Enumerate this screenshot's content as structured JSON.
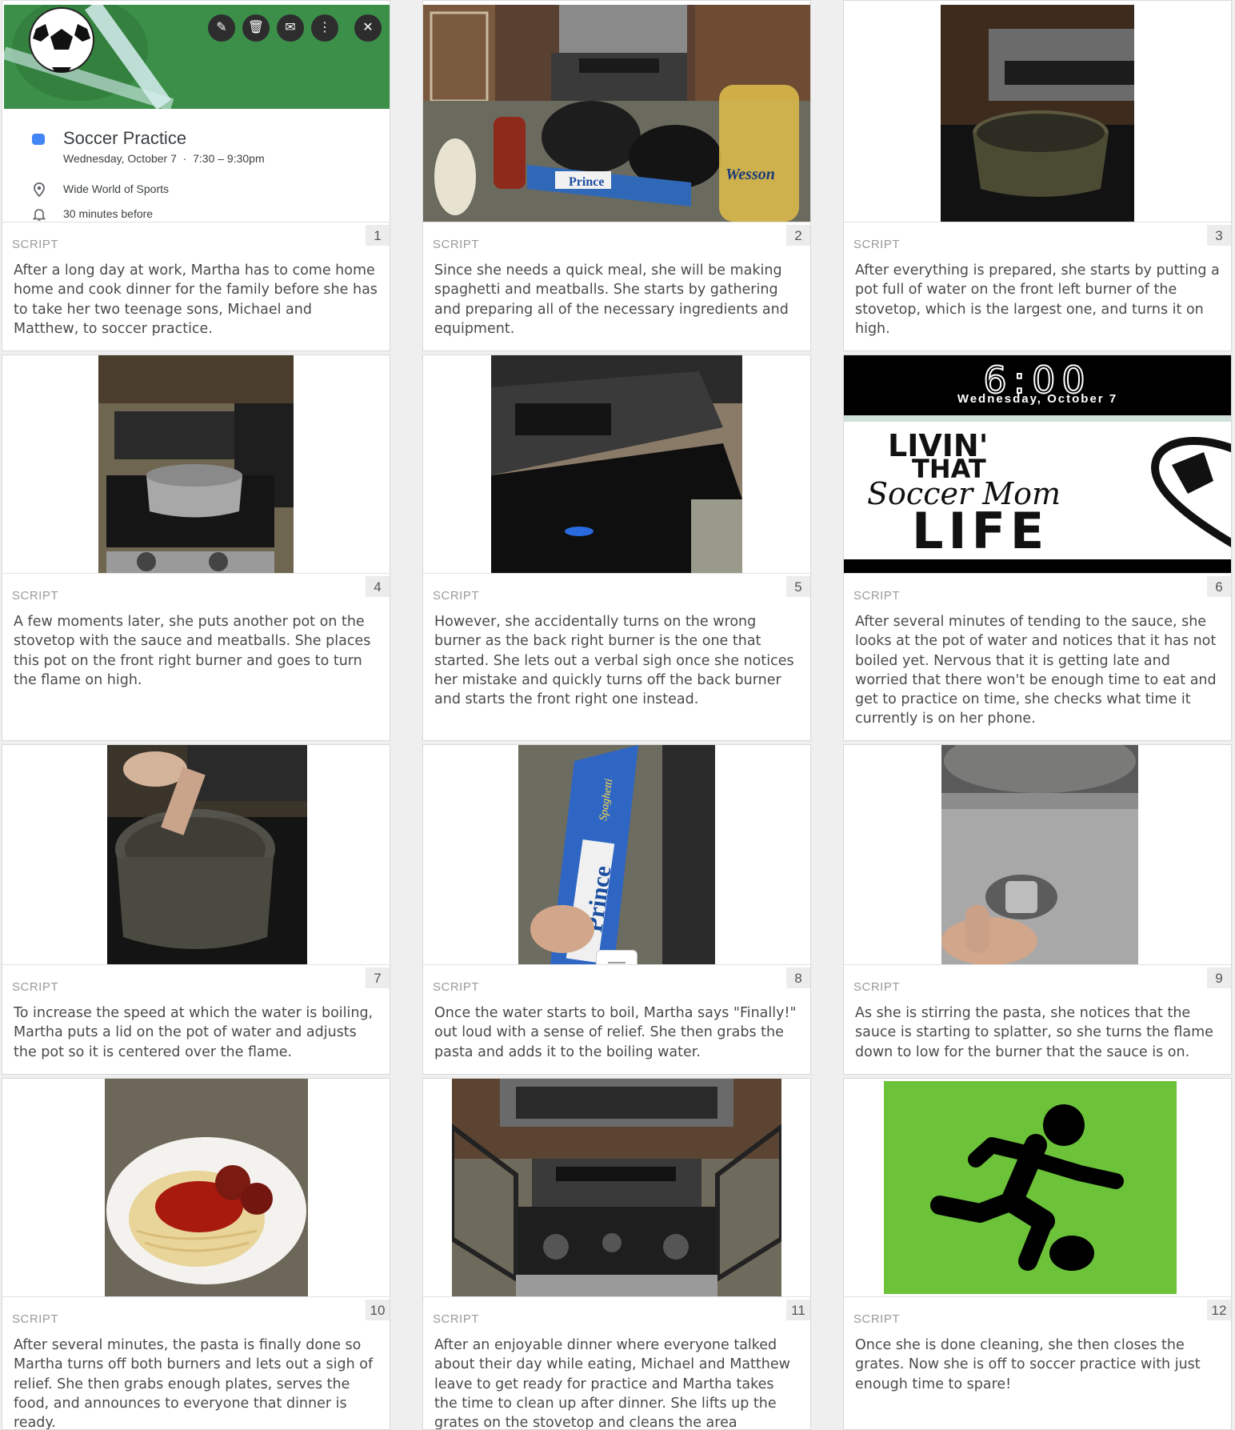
{
  "calendar_event": {
    "title": "Soccer Practice",
    "date_time": "Wednesday, October 7  ·  7:30 – 9:30pm",
    "location": "Wide World of Sports",
    "reminder": "30 minutes before",
    "color": "#4285f4",
    "toolbar": [
      "pencil-icon",
      "trash-icon",
      "envelope-icon",
      "more-vert-icon",
      "close-icon"
    ]
  },
  "phone_lock_screen": {
    "time": "6:00",
    "date": "Wednesday, October 7",
    "graphic_text": [
      "LIVIN'",
      "THAT",
      "Soccer Mom",
      "LIFE"
    ]
  },
  "product_labels": {
    "pasta_brand": "Prince",
    "pasta_type": "Spaghetti",
    "oil_brand": "Wesson"
  },
  "script_label": "SCRIPT",
  "panels": [
    {
      "number": "1",
      "text": "After a long day at work, Martha has to come home home and cook dinner for the family before she has to take her two teenage sons, Michael and Matthew, to soccer practice."
    },
    {
      "number": "2",
      "text": "Since she needs a quick meal, she will be making spaghetti and meatballs. She starts by gathering and preparing all of the necessary ingredients and equipment."
    },
    {
      "number": "3",
      "text": "After everything is prepared, she starts by putting a pot full of water on the front left burner of the stovetop, which is the largest one, and turns it on high."
    },
    {
      "number": "4",
      "text": "A few moments later, she puts another pot on the stovetop with the sauce and meatballs. She places this pot on the front right burner and goes to turn the flame on high."
    },
    {
      "number": "5",
      "text": "However, she accidentally turns on the wrong burner as the back right burner is the one that started. She lets out a verbal sigh once she notices her mistake and quickly turns off the back burner and starts the front right one instead."
    },
    {
      "number": "6",
      "text": "After several minutes of tending to the sauce, she looks at the pot of water and notices that it has not boiled yet. Nervous that it is getting late and worried that there won't be enough time to eat and get to practice on time, she checks what time it currently is on her phone."
    },
    {
      "number": "7",
      "text": "To increase the speed at which the water is boiling, Martha puts a lid on the pot of water and adjusts the pot so it is centered over the flame."
    },
    {
      "number": "8",
      "text": "Once the water starts to boil, Martha says \"Finally!\" out loud with a sense of relief. She then grabs the pasta and adds it to the boiling water."
    },
    {
      "number": "9",
      "text": "As she is stirring the pasta, she notices that the sauce is starting to splatter, so she turns the flame down to low for the burner that the sauce is on."
    },
    {
      "number": "10",
      "text": "After several minutes, the pasta is finally done so Martha turns off both burners and lets out a sigh of relief. She then grabs enough plates, serves the food, and announces to everyone that dinner is ready."
    },
    {
      "number": "11",
      "text": "After an enjoyable dinner where everyone talked about their day while eating, Michael and Matthew leave to get ready for practice and Martha takes the time to clean up after dinner. She lifts up the grates on the stovetop and cleans the area underneath."
    },
    {
      "number": "12",
      "text": "Once she is done cleaning, she then closes the grates. Now she is off to soccer practice with just enough time to spare!"
    }
  ]
}
